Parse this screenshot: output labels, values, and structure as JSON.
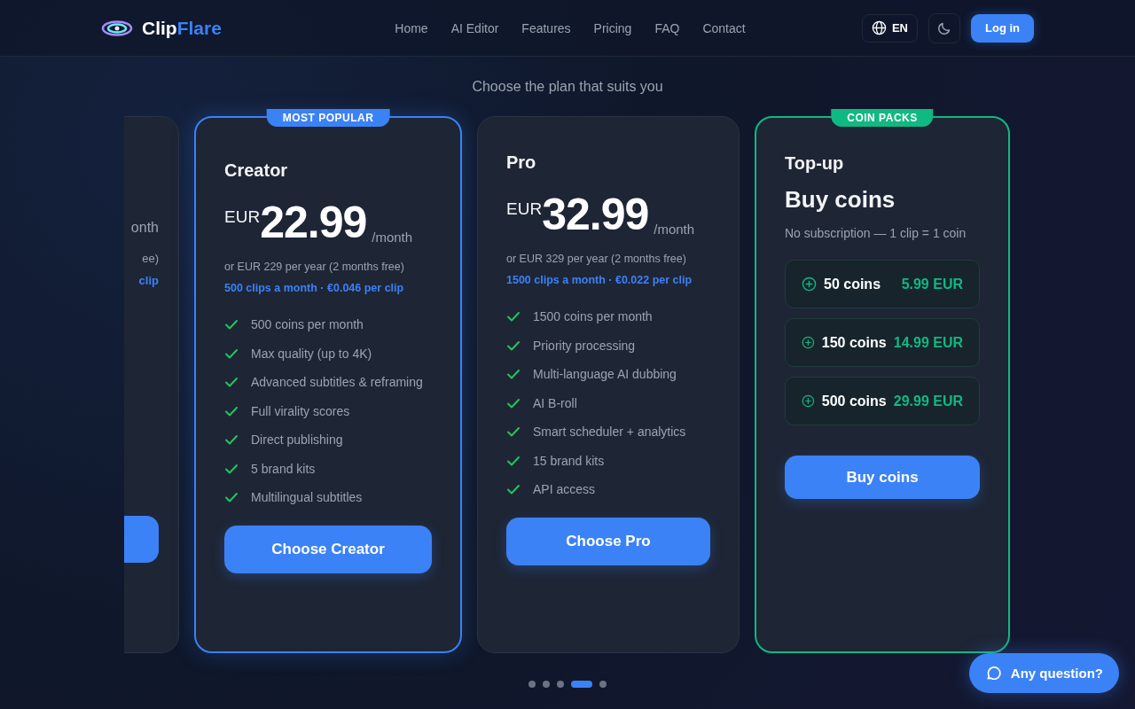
{
  "header": {
    "logo_first": "Clip",
    "logo_second": "Flare",
    "nav": [
      {
        "label": "Home"
      },
      {
        "label": "AI Editor"
      },
      {
        "label": "Features"
      },
      {
        "label": "Pricing"
      },
      {
        "label": "FAQ"
      },
      {
        "label": "Contact"
      }
    ],
    "language": "EN",
    "login": "Log in"
  },
  "subtitle": "Choose the plan that suits you",
  "cards": [
    {
      "kind": "clipped",
      "period": "onth",
      "yearly": "ee)",
      "clips": "clip"
    },
    {
      "kind": "plan",
      "badge": "MOST POPULAR",
      "color": "#3b82f6",
      "name": "Creator",
      "currency": "EUR",
      "price": "22.99",
      "period": "/month",
      "yearly": "or EUR 229 per year (2 months free)",
      "clips": "500 clips a month · €0.046 per clip",
      "features": [
        "500 coins per month",
        "Max quality (up to 4K)",
        "Advanced subtitles & reframing",
        "Full virality scores",
        "Direct publishing",
        "5 brand kits",
        "Multilingual subtitles"
      ],
      "button": "Choose Creator"
    },
    {
      "kind": "plan",
      "name": "Pro",
      "currency": "EUR",
      "price": "32.99",
      "period": "/month",
      "yearly": "or EUR 329 per year (2 months free)",
      "clips": "1500 clips a month · €0.022 per clip",
      "features": [
        "1500 coins per month",
        "Priority processing",
        "Multi-language AI dubbing",
        "AI B-roll",
        "Smart scheduler + analytics",
        "15 brand kits",
        "API access"
      ],
      "button": "Choose Pro"
    },
    {
      "kind": "coins",
      "badge": "COIN PACKS",
      "color": "#10b981",
      "name": "Top-up",
      "heading": "Buy coins",
      "note": "No subscription — 1 clip = 1 coin",
      "packs": [
        {
          "amount": "50 coins",
          "price": "5.99 EUR"
        },
        {
          "amount": "150 coins",
          "price": "14.99 EUR"
        },
        {
          "amount": "500 coins",
          "price": "29.99 EUR"
        }
      ],
      "button": "Buy coins"
    }
  ],
  "dots": [
    {
      "selected": false
    },
    {
      "selected": false
    },
    {
      "selected": false
    },
    {
      "selected": true
    },
    {
      "selected": false
    }
  ],
  "chat": "Any question?"
}
